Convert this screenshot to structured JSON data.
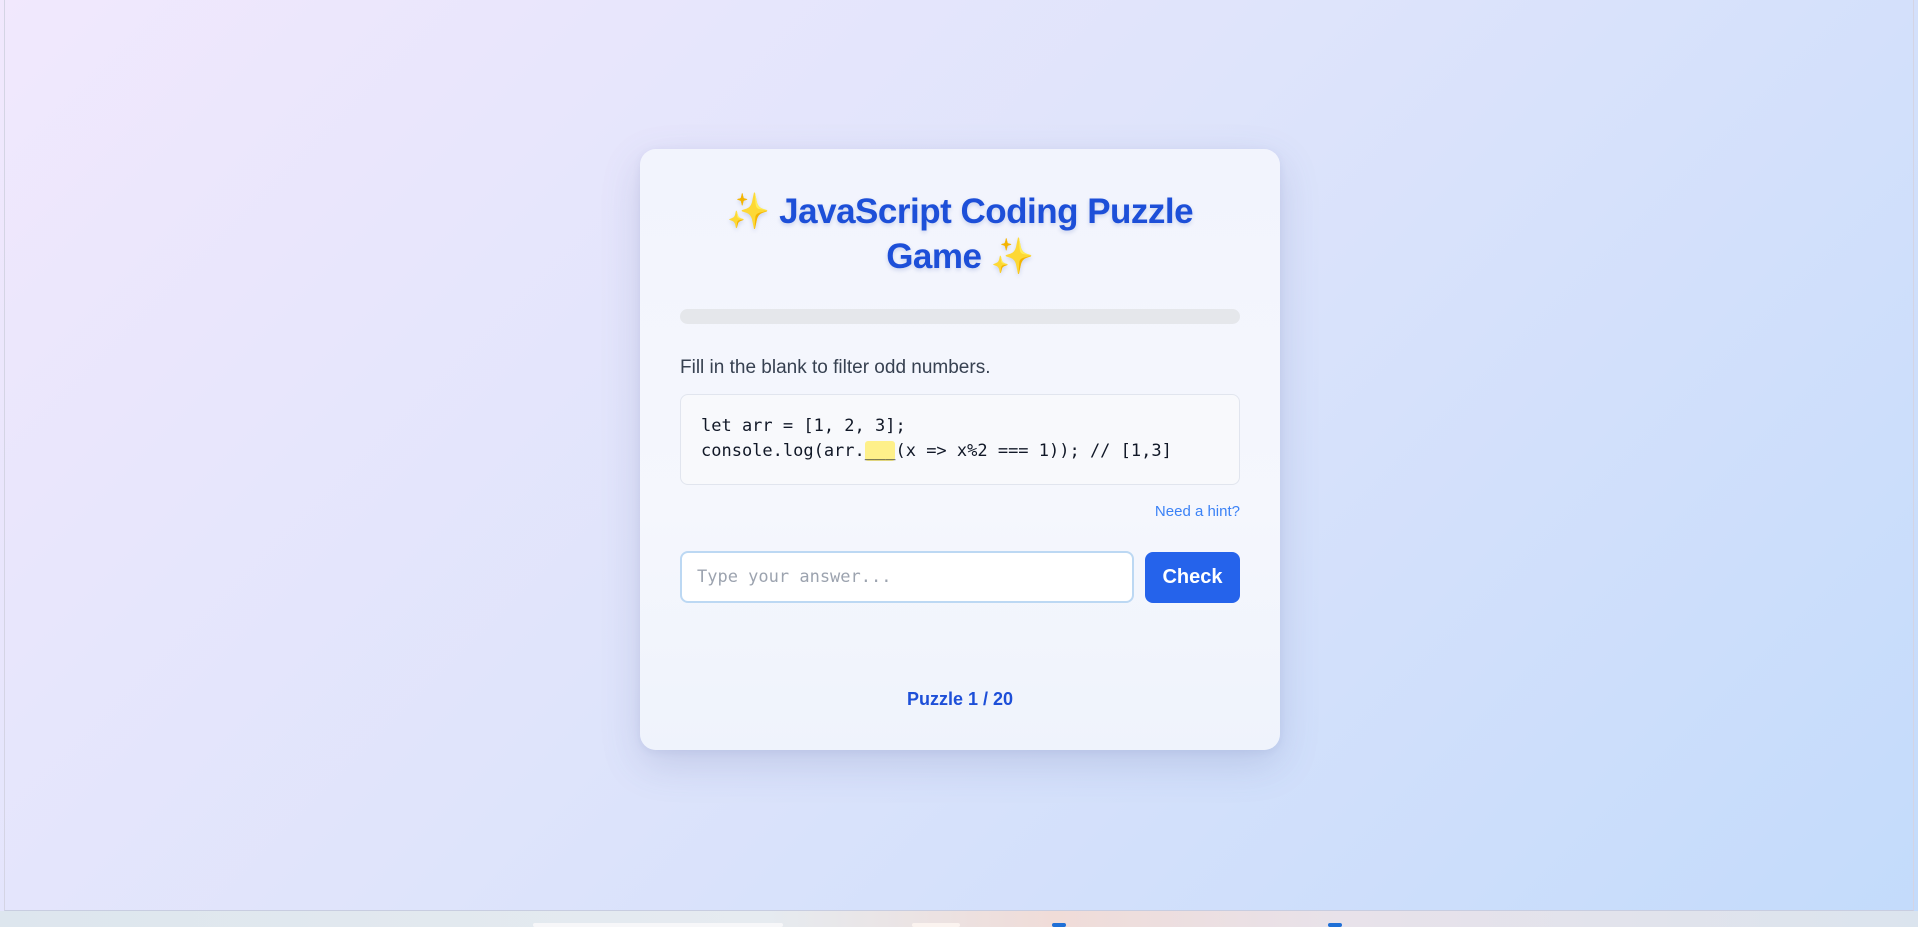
{
  "game": {
    "title": "✨ JavaScript Coding Puzzle Game ✨",
    "progress_fraction": 0.0,
    "prompt": "Fill in the blank to filter odd numbers.",
    "code": {
      "line1": "let arr = [1, 2, 3];",
      "line2_before": "console.log(arr.",
      "line2_blank": "___",
      "line2_after": "(x => x%2 === 1)); // [1,3]"
    },
    "hint_label": "Need a hint?",
    "answer_placeholder": "Type your answer...",
    "answer_value": "",
    "check_label": "Check",
    "counter": "Puzzle 1 / 20"
  },
  "colors": {
    "accent": "#2563eb",
    "title": "#1d4fd8",
    "blank_highlight": "#fef08a",
    "progress_track": "#e5e7eb"
  }
}
